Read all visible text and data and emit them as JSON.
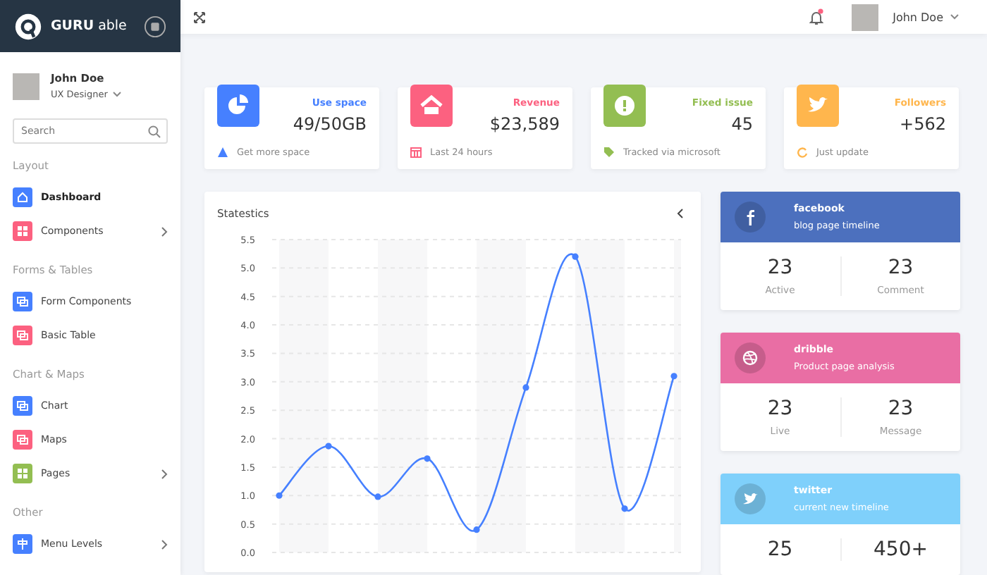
{
  "brand": {
    "name_bold": "GURU",
    "name_light": "able"
  },
  "header": {
    "user_name": "John Doe",
    "notification_dot": true
  },
  "sidebar": {
    "user": {
      "name": "John Doe",
      "role": "UX Designer"
    },
    "search": {
      "placeholder": "Search"
    },
    "sections": [
      {
        "title": "Layout",
        "items": [
          {
            "label": "Dashboard",
            "color": "#4680ff",
            "selected": true,
            "submenu": false
          },
          {
            "label": "Components",
            "color": "#fc6180",
            "selected": false,
            "submenu": true
          }
        ]
      },
      {
        "title": "Forms & Tables",
        "items": [
          {
            "label": "Form Components",
            "color": "#4680ff",
            "selected": false,
            "submenu": false
          },
          {
            "label": "Basic Table",
            "color": "#fc6180",
            "selected": false,
            "submenu": false
          }
        ]
      },
      {
        "title": "Chart & Maps",
        "items": [
          {
            "label": "Chart",
            "color": "#4680ff",
            "selected": false,
            "submenu": false
          },
          {
            "label": "Maps",
            "color": "#fc6180",
            "selected": false,
            "submenu": false
          },
          {
            "label": "Pages",
            "color": "#93be52",
            "selected": false,
            "submenu": true
          }
        ]
      },
      {
        "title": "Other",
        "items": [
          {
            "label": "Menu Levels",
            "color": "#4680ff",
            "selected": false,
            "submenu": true
          }
        ]
      }
    ]
  },
  "stat_cards": [
    {
      "color": "#4680ff",
      "title": "Use space",
      "value": "49/50GB",
      "footer": "Get more space"
    },
    {
      "color": "#fc6180",
      "title": "Revenue",
      "value": "$23,589",
      "footer": "Last 24 hours"
    },
    {
      "color": "#93be52",
      "title": "Fixed issue",
      "value": "45",
      "footer": "Tracked via microsoft"
    },
    {
      "color": "#ffb64d",
      "title": "Followers",
      "value": "+562",
      "footer": "Just update"
    }
  ],
  "statistics": {
    "title": "Statestics",
    "chart_data": {
      "type": "line",
      "grid": true,
      "ylim": [
        0,
        5.5
      ],
      "series": [
        {
          "color": "#4680ff",
          "marker": true,
          "values": [
            1.0,
            1.87,
            0.98,
            1.65,
            0.4,
            2.9,
            5.2,
            0.77,
            3.1
          ]
        }
      ],
      "yticks": [
        {
          "value": 0,
          "label": "0.0"
        },
        {
          "value": 0.5,
          "label": "0.5"
        },
        {
          "value": 1,
          "label": "1.0"
        },
        {
          "value": 1.5,
          "label": "1.5"
        },
        {
          "value": 2,
          "label": "2.0"
        },
        {
          "value": 2.5,
          "label": "2.5"
        },
        {
          "value": 3,
          "label": "3.0"
        },
        {
          "value": 3.5,
          "label": "3.5"
        },
        {
          "value": 4,
          "label": "4.0"
        },
        {
          "value": 4.5,
          "label": "4.5"
        },
        {
          "value": 5,
          "label": "5.0"
        },
        {
          "value": 5.5,
          "label": "5.5"
        }
      ]
    }
  },
  "social_cards": [
    {
      "color": "#4c70be",
      "title": "facebook",
      "subtitle": "blog page timeline",
      "stats": [
        {
          "value": "23",
          "label": "Active"
        },
        {
          "value": "23",
          "label": "Comment"
        }
      ]
    },
    {
      "color": "#e96ea4",
      "title": "dribble",
      "subtitle": "Product page analysis",
      "stats": [
        {
          "value": "23",
          "label": "Live"
        },
        {
          "value": "23",
          "label": "Message"
        }
      ]
    },
    {
      "color": "#7fd0fb",
      "title": "twitter",
      "subtitle": "current new timeline",
      "stats": [
        {
          "value": "25"
        },
        {
          "value": "450+"
        }
      ]
    }
  ]
}
